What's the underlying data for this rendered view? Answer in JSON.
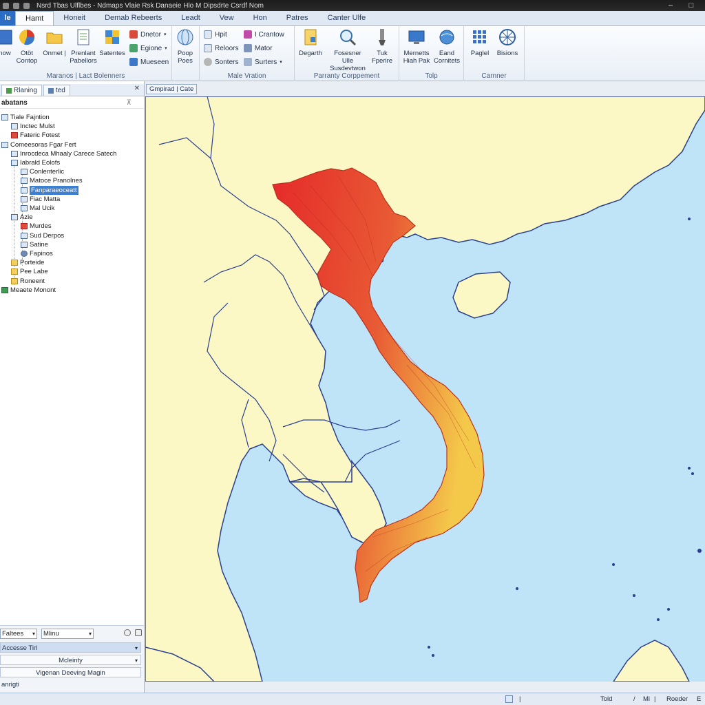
{
  "window": {
    "title": "Nsrd Tbas Ulflbes - Ndmaps Vlaie Rsk Danaeie Hlo M Dipsdrte Csrdf Nom"
  },
  "file_tab": "le",
  "tabs": [
    {
      "label": "Hamt",
      "active": true
    },
    {
      "label": "Honeit"
    },
    {
      "label": "Demab Rebeerts"
    },
    {
      "label": "Leadt"
    },
    {
      "label": "Vew"
    },
    {
      "label": "Hon"
    },
    {
      "label": "Patres"
    },
    {
      "label": "Canter Ulfe"
    }
  ],
  "ribbon": {
    "groups": [
      {
        "label": "Maranos | Lact Bolenners",
        "big_buttons": [
          "now",
          "Otöt Contop",
          "Onmet | ",
          "Prenlant Pabellors",
          "Satentes"
        ],
        "small_buttons": [
          "Dnetor",
          "Egione",
          "Mueseen"
        ]
      },
      {
        "label": "",
        "big_buttons": [
          "Poop Poes"
        ],
        "small_buttons": []
      },
      {
        "label": "Male Vration",
        "big_buttons": [],
        "small_buttons": [
          "Hpit",
          "Reloors",
          "Sonters",
          "I Crantow",
          "Mator",
          "Surters"
        ]
      },
      {
        "label": "Parranty Corppement",
        "big_buttons": [
          "Degarth",
          "Fosesner Ulle Susdevtwon",
          "Tuk Fperire"
        ],
        "small_buttons": []
      },
      {
        "label": "Tolp",
        "big_buttons": [
          "Mernetts Hiah Pak",
          "Eand Cornitets"
        ],
        "small_buttons": []
      },
      {
        "label": "Carnner",
        "big_buttons": [
          "Paglel",
          "Bisions"
        ],
        "small_buttons": []
      }
    ]
  },
  "left_panel": {
    "tabs": [
      "Rlaning",
      "ted"
    ],
    "header": "abatans",
    "tree": [
      {
        "label": "Tiale Fajntion",
        "icon": "doc"
      },
      {
        "label": "Inctec Mulst",
        "icon": "doc"
      },
      {
        "label": "Fateric Fotest",
        "icon": "red"
      },
      {
        "label": "Comeesoras Fgar Fert",
        "icon": "doc"
      },
      {
        "label": "Inrocdeca Mhaaly Carece Satech",
        "icon": "doc"
      },
      {
        "label": "Iabrald Eolofs",
        "icon": "doc"
      },
      {
        "label": "Conlenterlic",
        "icon": "doc"
      },
      {
        "label": "Matoce Pranolnes",
        "icon": "doc"
      },
      {
        "label": "Fanparaeoceatt",
        "icon": "doc",
        "selected": true
      },
      {
        "label": "Fiac Matta",
        "icon": "doc"
      },
      {
        "label": "Mal Ucik",
        "icon": "doc"
      },
      {
        "label": "Azie",
        "icon": "doc"
      },
      {
        "label": "Murdes",
        "icon": "red"
      },
      {
        "label": "Sud Derpos",
        "icon": "doc"
      },
      {
        "label": "Satine",
        "icon": "doc"
      },
      {
        "label": "Fapinos",
        "icon": "gear"
      },
      {
        "label": "Porteide",
        "icon": "fold"
      },
      {
        "label": "Pee Labe",
        "icon": "fold"
      },
      {
        "label": "Roneent",
        "icon": "fold"
      },
      {
        "label": "Meaete Monont",
        "icon": "green"
      }
    ],
    "bottom": {
      "select1": "Faltees",
      "select2": "Mlinu",
      "rows": [
        "Accesse Tirl",
        "Mcleinty",
        "Vigenan Deeving Magin",
        "anrigti"
      ]
    }
  },
  "map": {
    "tab_label": "Gmpirad | Cate",
    "colors": {
      "sea": "#bfe4f7",
      "land": "#fbf8c6",
      "border": "#2a3f8f",
      "highlight_start": "#e52a2a",
      "highlight_end": "#f4c94a"
    }
  },
  "statusbar": {
    "left_text": "",
    "items": [
      "Told",
      "Mi",
      "Roeder",
      "E"
    ]
  }
}
